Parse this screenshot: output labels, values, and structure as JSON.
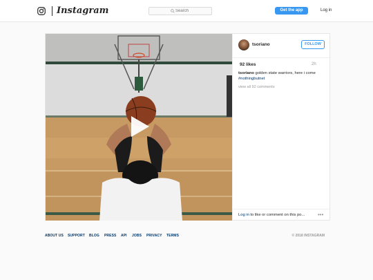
{
  "header": {
    "logo_text": "Instagram",
    "search_placeholder": "Search",
    "get_app_label": "Get the app",
    "login_label": "Log in"
  },
  "post": {
    "username": "tsoriano",
    "follow_label": "FOLLOW",
    "likes": "92 likes",
    "age": "2h",
    "caption_user": "tsoriano",
    "caption_text": " golden state warriors, here i come ",
    "caption_hashtag": "#nothingbutnet",
    "view_all_comments": "view all 92 comments",
    "login_link": "Log in",
    "login_text": " to like or comment on this po...",
    "more": "•••"
  },
  "footer": {
    "links": [
      "ABOUT US",
      "SUPPORT",
      "BLOG",
      "PRESS",
      "API",
      "JOBS",
      "PRIVACY",
      "TERMS"
    ],
    "copyright": "© 2018 INSTAGRAM"
  },
  "colors": {
    "accent": "#3897f0",
    "link": "#003569",
    "muted": "#999999"
  },
  "icons": {
    "logo": "instagram-camera-icon",
    "search": "search-icon",
    "play": "play-icon"
  }
}
